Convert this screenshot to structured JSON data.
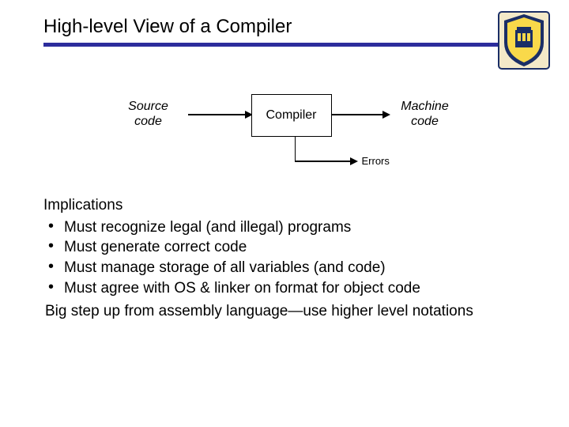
{
  "title": "High-level View of a Compiler",
  "diagram": {
    "source_l1": "Source",
    "source_l2": "code",
    "box": "Compiler",
    "machine_l1": "Machine",
    "machine_l2": "code",
    "errors": "Errors"
  },
  "implications": {
    "heading": "Implications",
    "items": [
      "Must recognize legal (and illegal) programs",
      "Must generate correct code",
      "Must manage storage of all variables (and code)",
      "Must agree with OS & linker on format for object code"
    ],
    "closing": "Big step up from assembly language—use higher level notations"
  }
}
